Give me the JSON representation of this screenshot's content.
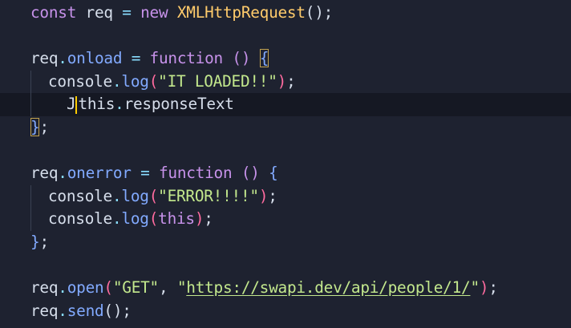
{
  "editor": {
    "lines": {
      "l1": {
        "kw": "const",
        "name": " req ",
        "eq": "=",
        "sp": " ",
        "new": "new",
        "sp2": " ",
        "cls": "XMLHttpRequest",
        "open": "(",
        "close": ")",
        "semi": ";"
      },
      "l3": {
        "obj": "req",
        "dot": ".",
        "prop": "onload",
        "eq": " = ",
        "kw": "function",
        "sp": " ",
        "params": "()",
        "sp2": " ",
        "brace": "{"
      },
      "l4": {
        "obj": "console",
        "dot": ".",
        "method": "log",
        "open": "(",
        "str": "\"IT LOADED!!\"",
        "close": ")",
        "semi": ";"
      },
      "l5": {
        "typed": "J",
        "kw": "this",
        "dot": ".",
        "prop": "responseText"
      },
      "l6": {
        "brace": "}",
        "semi": ";"
      },
      "l8": {
        "obj": "req",
        "dot": ".",
        "prop": "onerror",
        "eq": " = ",
        "kw": "function",
        "sp": " ",
        "params": "()",
        "sp2": " ",
        "brace": "{"
      },
      "l9": {
        "obj": "console",
        "dot": ".",
        "method": "log",
        "open": "(",
        "str": "\"ERROR!!!!\"",
        "close": ")",
        "semi": ";"
      },
      "l10": {
        "obj": "console",
        "dot": ".",
        "method": "log",
        "open": "(",
        "kw": "this",
        "close": ")",
        "semi": ";"
      },
      "l11": {
        "brace": "}",
        "semi": ";"
      },
      "l13": {
        "obj": "req",
        "dot": ".",
        "method": "open",
        "open": "(",
        "str1": "\"GET\"",
        "comma": ", ",
        "q1": "\"",
        "url": "https://swapi.dev/api/people/1/",
        "q2": "\"",
        "close": ")",
        "semi": ";"
      },
      "l14": {
        "obj": "req",
        "dot": ".",
        "method": "send",
        "parens": "()",
        "semi": ";"
      }
    },
    "colors": {
      "background": "#1e2230",
      "keyword": "#c792ea",
      "function": "#82aaff",
      "class": "#ffcb6b",
      "string": "#c3e88d",
      "punctuation": "#89ddff",
      "paren": "#ff6b9f",
      "cursor": "#ffcc00"
    }
  }
}
